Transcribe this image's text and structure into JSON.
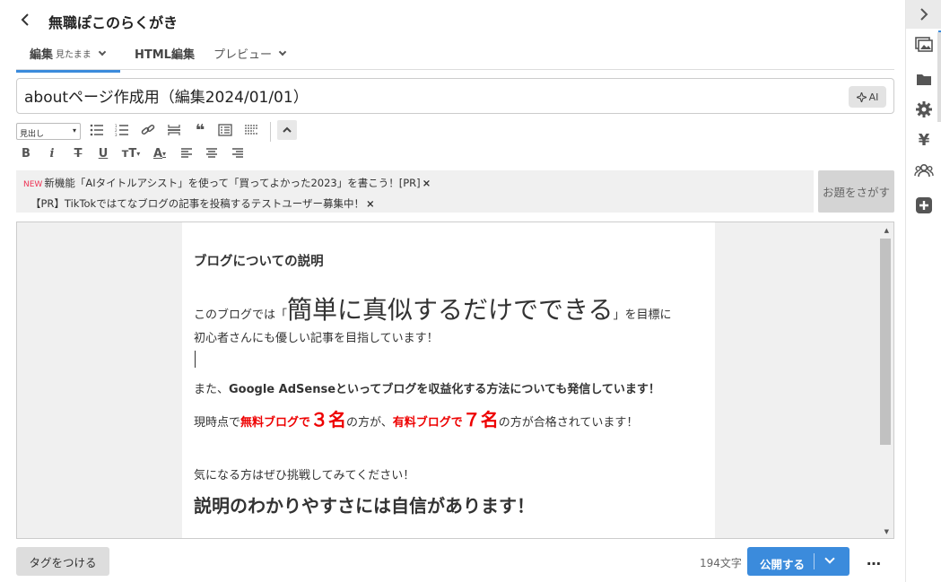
{
  "header": {
    "blog_title": "無職ぽこのらくがき",
    "tabs": [
      {
        "label": "編集",
        "sub": "見たまま"
      },
      {
        "label": "HTML編集"
      },
      {
        "label": "プレビュー"
      }
    ]
  },
  "title_field": {
    "value": "aboutページ作成用（編集2024/01/01）"
  },
  "ai_button": "AI",
  "toolbar": {
    "heading_select": "見出し",
    "icons": [
      "bullet-list-icon",
      "numbered-list-icon",
      "link-icon",
      "horizontal-rule-icon",
      "quote-icon",
      "table-of-contents-icon",
      "read-more-icon",
      "bold-icon",
      "italic-icon",
      "strikethrough-icon",
      "underline-icon",
      "font-size-icon",
      "font-color-icon",
      "align-left-icon",
      "align-center-icon",
      "align-right-icon",
      "collapse-toolbar-icon"
    ],
    "bold": "B",
    "italic": "i",
    "strike": "T",
    "underline": "U",
    "fontsize": "тT",
    "fontcolor": "A"
  },
  "notice": {
    "badge": "NEW",
    "line1": "新機能「AIタイトルアシスト」を使って「買ってよかった2023」を書こう！[PR]",
    "line2": "【PR】TikTokではてなブログの記事を投稿するテストユーザー募集中！",
    "close": "×",
    "topic_button": "お題をさがす"
  },
  "content": {
    "heading": "ブログについての説明",
    "p1_pre": "このブログでは「",
    "p1_big": "簡単に真似するだけでできる",
    "p1_post": "」を目標に",
    "p2": "初心者さんにも優しい記事を目指しています！",
    "p3_pre": "また、",
    "p3_bold": "Google AdSenseといってブログを収益化する方法についても発信しています！",
    "p4_a": "現時点で",
    "p4_b": "無料ブログで",
    "p4_c": "３名",
    "p4_d": "の方が、",
    "p4_e": "有料ブログで",
    "p4_f": "７名",
    "p4_g": "の方が合格されています！",
    "p5": "気になる方はぜひ挑戦してみてください！",
    "p6": "説明のわかりやすさには自信があります！"
  },
  "footer": {
    "tag_button": "タグをつける",
    "char_count": "194文字",
    "publish_button": "公開する",
    "more": "…"
  },
  "sidebar": {
    "icons": [
      "collapse-sidebar-icon",
      "image-icon",
      "folder-icon",
      "gear-icon",
      "yen-icon",
      "group-icon",
      "plus-icon"
    ]
  },
  "colors": {
    "accent": "#3b8bdc",
    "highlight": "#ee0000"
  }
}
